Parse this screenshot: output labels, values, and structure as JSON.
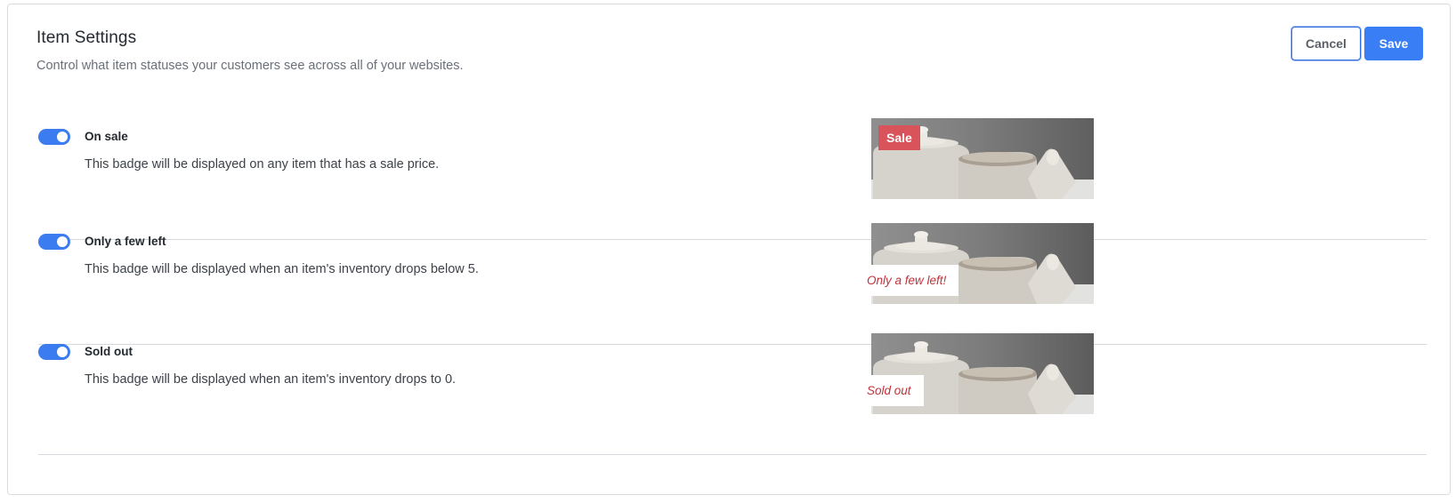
{
  "header": {
    "title": "Item Settings",
    "subtitle": "Control what item statuses your customers see across all of your websites.",
    "cancel_label": "Cancel",
    "save_label": "Save"
  },
  "settings": [
    {
      "title": "On sale",
      "description": "This badge will be displayed on any item that has a sale price.",
      "enabled": true,
      "badge": "Sale"
    },
    {
      "title": "Only a few left",
      "description": "This badge will be displayed when an item's inventory drops below 5.",
      "enabled": true,
      "badge": "Only a few left!"
    },
    {
      "title": "Sold out",
      "description": "This badge will be displayed when an item's inventory drops to 0.",
      "enabled": true,
      "badge": "Sold out"
    }
  ],
  "colors": {
    "accent": "#3a7ef5",
    "toggle_on": "#3b7cf0",
    "sale_badge": "#d9535b",
    "note_text": "#c0313a"
  }
}
